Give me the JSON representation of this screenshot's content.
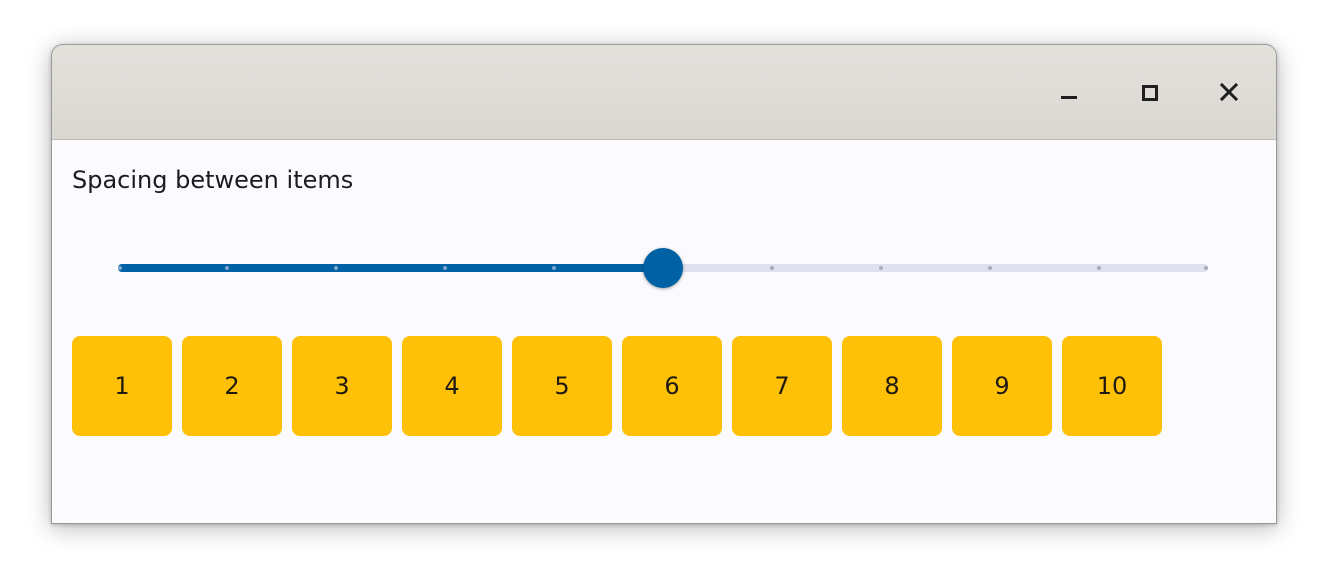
{
  "window": {
    "controls": {
      "minimize_icon": "minimize-icon",
      "maximize_icon": "maximize-icon",
      "close_icon": "close-icon"
    }
  },
  "main": {
    "label": "Spacing between items",
    "slider": {
      "min": 0,
      "max": 10,
      "step": 1,
      "value": 5,
      "active_color": "#0061a4",
      "inactive_color": "#dfe2ee"
    },
    "items": [
      "1",
      "2",
      "3",
      "4",
      "5",
      "6",
      "7",
      "8",
      "9",
      "10"
    ],
    "item_color": "#ffc107"
  }
}
